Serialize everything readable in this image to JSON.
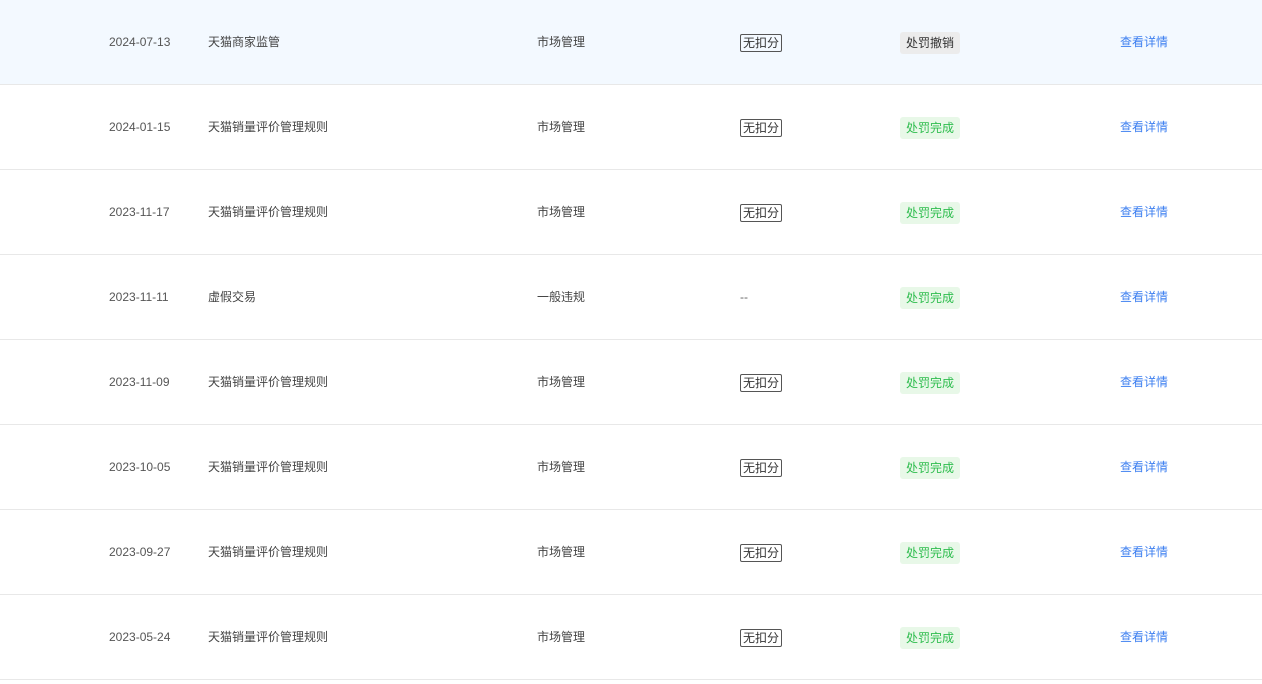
{
  "colors": {
    "highlight_row_bg": "#f3f9ff",
    "status_done_bg": "#e8f8e8",
    "status_done_text": "#2ebd4e",
    "status_revoked_bg": "#ececec",
    "link": "#3d7ff0",
    "divider": "#e8e8e8"
  },
  "rows": [
    {
      "date": "2024-07-13",
      "rule": "天猫商家监管",
      "type": "市场管理",
      "score": "无扣分",
      "status": "处罚撤销",
      "status_kind": "revoked",
      "action": "查看详情",
      "highlight": true
    },
    {
      "date": "2024-01-15",
      "rule": "天猫销量评价管理规则",
      "type": "市场管理",
      "score": "无扣分",
      "status": "处罚完成",
      "status_kind": "done",
      "action": "查看详情",
      "highlight": false
    },
    {
      "date": "2023-11-17",
      "rule": "天猫销量评价管理规则",
      "type": "市场管理",
      "score": "无扣分",
      "status": "处罚完成",
      "status_kind": "done",
      "action": "查看详情",
      "highlight": false
    },
    {
      "date": "2023-11-11",
      "rule": "虚假交易",
      "type": "一般违规",
      "score": "--",
      "status": "处罚完成",
      "status_kind": "done",
      "action": "查看详情",
      "highlight": false
    },
    {
      "date": "2023-11-09",
      "rule": "天猫销量评价管理规则",
      "type": "市场管理",
      "score": "无扣分",
      "status": "处罚完成",
      "status_kind": "done",
      "action": "查看详情",
      "highlight": false
    },
    {
      "date": "2023-10-05",
      "rule": "天猫销量评价管理规则",
      "type": "市场管理",
      "score": "无扣分",
      "status": "处罚完成",
      "status_kind": "done",
      "action": "查看详情",
      "highlight": false
    },
    {
      "date": "2023-09-27",
      "rule": "天猫销量评价管理规则",
      "type": "市场管理",
      "score": "无扣分",
      "status": "处罚完成",
      "status_kind": "done",
      "action": "查看详情",
      "highlight": false
    },
    {
      "date": "2023-05-24",
      "rule": "天猫销量评价管理规则",
      "type": "市场管理",
      "score": "无扣分",
      "status": "处罚完成",
      "status_kind": "done",
      "action": "查看详情",
      "highlight": false
    }
  ]
}
